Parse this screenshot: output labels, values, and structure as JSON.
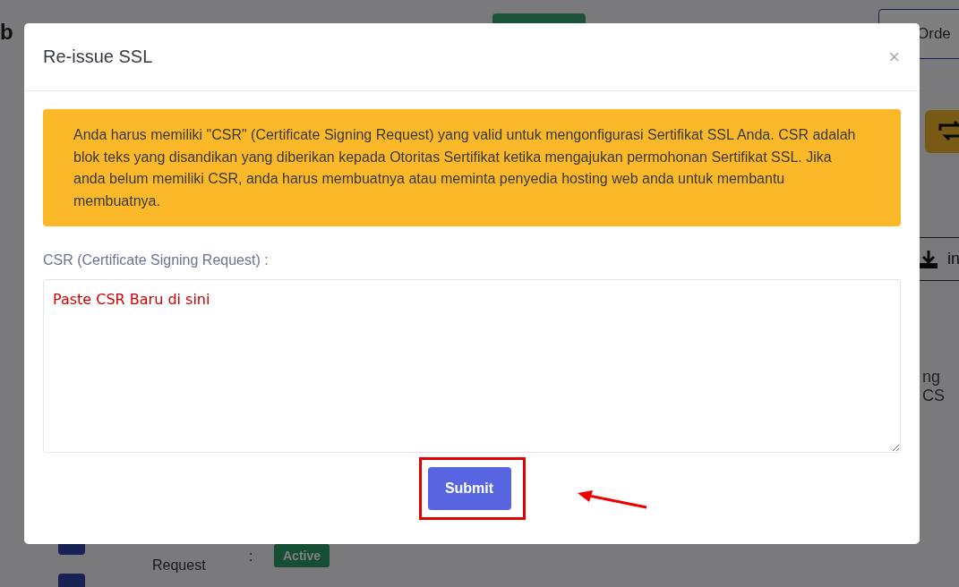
{
  "background": {
    "title_fragment": "b",
    "order_button": "Orde",
    "download_link": "in",
    "text_fragment": "ng CS",
    "status_label": "Request",
    "separator": ":",
    "status_badge": "Active"
  },
  "modal": {
    "title": "Re-issue SSL",
    "close": "×",
    "alert": "Anda harus memiliki \"CSR\" (Certificate Signing Request) yang valid untuk mengonfigurasi Sertifikat SSL Anda. CSR adalah blok teks yang disandikan yang diberikan kepada Otoritas Sertifikat ketika mengajukan permohonan Sertifikat SSL. Jika anda belum memiliki CSR, anda harus membuatnya atau meminta penyedia hosting web anda untuk membantu membuatnya.",
    "field_label": "CSR (Certificate Signing Request) :",
    "placeholder": "Paste CSR Baru di sini",
    "submit": "Submit"
  }
}
